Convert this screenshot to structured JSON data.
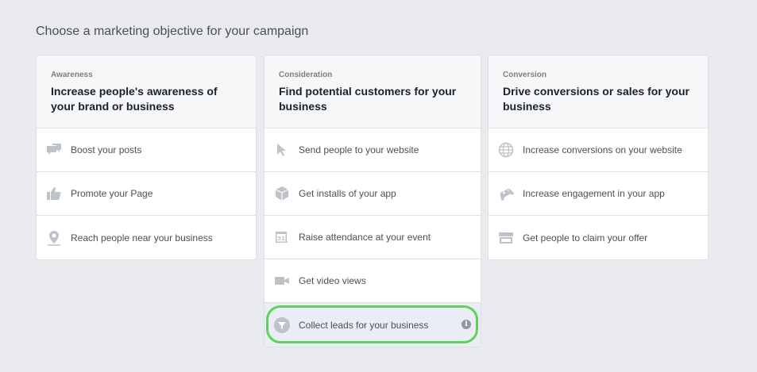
{
  "page": {
    "heading": "Choose a marketing objective for your campaign"
  },
  "columns": [
    {
      "category": "Awareness",
      "title": "Increase people's awareness of your brand or business",
      "items": [
        {
          "label": "Boost your posts",
          "icon": "chat-bubbles-icon"
        },
        {
          "label": "Promote your Page",
          "icon": "thumbs-up-icon"
        },
        {
          "label": "Reach people near your business",
          "icon": "map-pin-icon"
        }
      ]
    },
    {
      "category": "Consideration",
      "title": "Find potential customers for your business",
      "items": [
        {
          "label": "Send people to your website",
          "icon": "cursor-icon"
        },
        {
          "label": "Get installs of your app",
          "icon": "box-icon"
        },
        {
          "label": "Raise attendance at your event",
          "icon": "calendar-icon",
          "icon_text": "31"
        },
        {
          "label": "Get video views",
          "icon": "video-camera-icon"
        },
        {
          "label": "Collect leads for your business",
          "icon": "funnel-icon",
          "selected": true,
          "info": "i"
        }
      ]
    },
    {
      "category": "Conversion",
      "title": "Drive conversions or sales for your business",
      "items": [
        {
          "label": "Increase conversions on your website",
          "icon": "globe-icon"
        },
        {
          "label": "Increase engagement in your app",
          "icon": "gamepad-icon"
        },
        {
          "label": "Get people to claim your offer",
          "icon": "storefront-icon"
        }
      ]
    }
  ],
  "colors": {
    "icon": "#bec2c9",
    "highlight": "#5dd35a",
    "selected_bg": "#eaedf6"
  }
}
